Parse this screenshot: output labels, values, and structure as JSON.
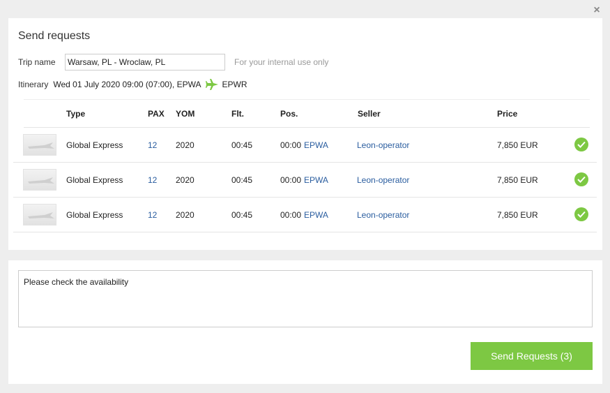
{
  "header": {
    "title": "Send requests",
    "close_icon": "close-icon"
  },
  "trip": {
    "label": "Trip name",
    "value": "Warsaw, PL - Wroclaw, PL",
    "hint": "For your internal use only"
  },
  "itinerary": {
    "label": "Itinerary",
    "departure": "Wed 01 July 2020 09:00 (07:00), EPWA",
    "arrival": "EPWR",
    "icon": "plane-icon",
    "icon_color": "#7dc843"
  },
  "table": {
    "columns": [
      "Type",
      "PAX",
      "YOM",
      "Flt.",
      "Pos.",
      "Seller",
      "Price"
    ],
    "rows": [
      {
        "type": "Global Express",
        "pax": "12",
        "yom": "2020",
        "flt": "00:45",
        "pos_time": "00:00",
        "pos_code": "EPWA",
        "seller": "Leon-operator",
        "price": "7,850 EUR"
      },
      {
        "type": "Global Express",
        "pax": "12",
        "yom": "2020",
        "flt": "00:45",
        "pos_time": "00:00",
        "pos_code": "EPWA",
        "seller": "Leon-operator",
        "price": "7,850 EUR"
      },
      {
        "type": "Global Express",
        "pax": "12",
        "yom": "2020",
        "flt": "00:45",
        "pos_time": "00:00",
        "pos_code": "EPWA",
        "seller": "Leon-operator",
        "price": "7,850 EUR"
      }
    ]
  },
  "message": {
    "value": "Please check the availability"
  },
  "actions": {
    "send_label": "Send Requests (3)"
  },
  "colors": {
    "accent": "#7dc843",
    "link": "#2a5d9f"
  }
}
